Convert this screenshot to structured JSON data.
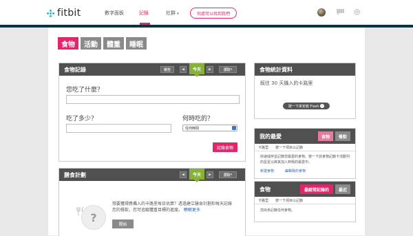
{
  "header": {
    "logo": "fitbit",
    "nav": [
      "數字面板",
      "記錄",
      "社群"
    ],
    "nav_caret": "▾",
    "pill_link": "何處可以找到我們"
  },
  "colors": {
    "brand": "#e2266b",
    "nav_stripe": "#003549",
    "today": "#88b13b",
    "logo_dots": "#3bb5b8"
  },
  "tabs": [
    "食物",
    "活動",
    "體重",
    "睡眠"
  ],
  "food_log": {
    "title": "食物記錄",
    "report_btn": "報告",
    "today": "今天",
    "select_btn": "選取",
    "q_what": "您吃了什麼？",
    "q_amount": "吃了多少？",
    "q_when": "何時吃的？",
    "when_value": "任何時間",
    "log_btn": "記錄食物"
  },
  "diet_plan": {
    "title": "膳食計劃",
    "today": "今天",
    "select_btn": "選取",
    "text": "想要獲得應攝入的卡路里每日估算？透過建立膳食計劃和每天記錄您的餐飲，您可追蹤體重目標的進度。",
    "learn_more": "瞭解更多",
    "start_btn": "開始"
  },
  "food_stats": {
    "title": "食物統計資料",
    "subtitle": "既往 30 天攝入的卡路里",
    "flash_btn": "按一下來安裝 Flash"
  },
  "favorites": {
    "title": "我的最愛",
    "tab_food": "食物",
    "tab_meal": "餐飲",
    "col1": "卡路里",
    "col2": "按一下項目以記錄",
    "text": "快速儲存並記錄您最愛的食物。按一下該食物記錄卡活動列的星星以將其加入到我的最愛中。",
    "link1": "新建食物",
    "link2": "編輯我的食物"
  },
  "foods": {
    "title": "食物",
    "tab_frequent": "最經常記錄的",
    "tab_recent": "最近",
    "col1": "卡路里",
    "col2": "按一下項目以記錄",
    "empty": "您尚未記錄任何食物。"
  }
}
